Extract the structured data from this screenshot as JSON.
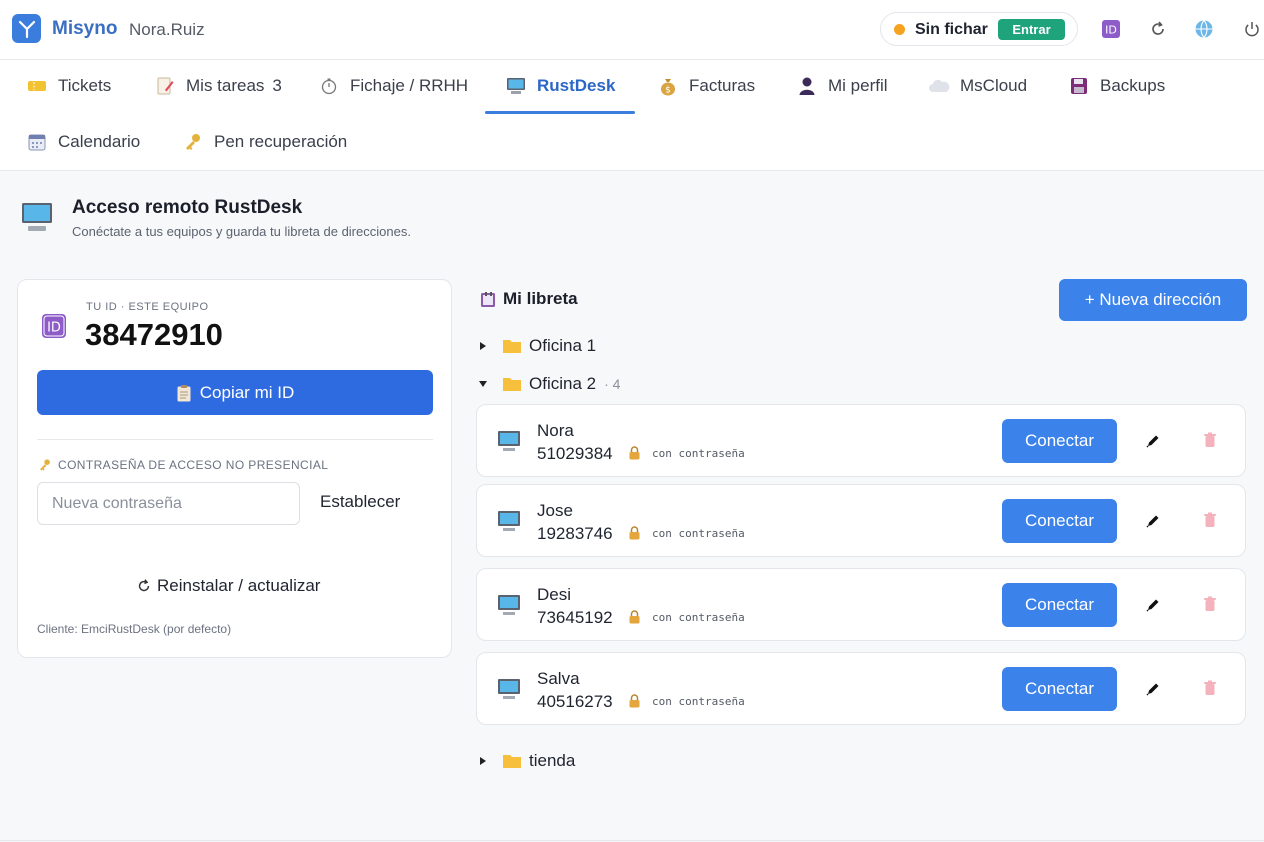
{
  "header": {
    "brand": "Misyno",
    "user": "Nora.Ruiz",
    "clock_status": "Sin fichar",
    "clock_button": "Entrar",
    "icons": [
      "id-card-icon",
      "refresh-icon",
      "globe-icon",
      "power-icon"
    ]
  },
  "nav": {
    "items": [
      {
        "label": "Tickets",
        "icon": "ticket-icon"
      },
      {
        "label": "Mis tareas",
        "badge": "3",
        "icon": "memo-icon"
      },
      {
        "label": "Fichaje / RRHH",
        "icon": "stopwatch-icon"
      },
      {
        "label": "RustDesk",
        "icon": "computer-icon",
        "active": true
      },
      {
        "label": "Facturas",
        "icon": "money-bag-icon"
      },
      {
        "label": "Mi perfil",
        "icon": "person-icon"
      },
      {
        "label": "MsCloud",
        "icon": "cloud-icon"
      },
      {
        "label": "Backups",
        "icon": "floppy-icon"
      },
      {
        "label": "Calendario",
        "icon": "calendar-icon"
      },
      {
        "label": "Pen recuperación",
        "icon": "key-icon"
      }
    ]
  },
  "page": {
    "title": "Acceso remoto RustDesk",
    "subtitle": "Conéctate a tus equipos y guarda tu libreta de direcciones."
  },
  "my_id": {
    "label": "TU ID · ESTE EQUIPO",
    "value": "38472910",
    "copy_button": "Copiar mi ID",
    "password_label": "CONTRASEÑA DE ACCESO NO PRESENCIAL",
    "password_placeholder": "Nueva contraseña",
    "set_button": "Establecer",
    "reinstall": "Reinstalar / actualizar",
    "client_note": "Cliente: EmciRustDesk (por defecto)"
  },
  "address_book": {
    "title": "Mi libreta",
    "new_button": "+ Nueva dirección",
    "groups": [
      {
        "name": "Oficina 1",
        "expanded": false
      },
      {
        "name": "Oficina 2",
        "expanded": true,
        "count": "· 4"
      },
      {
        "name": "tienda",
        "expanded": false
      }
    ],
    "devices": [
      {
        "name": "Nora",
        "id": "51029384",
        "pwd": "con contraseña"
      },
      {
        "name": "Jose",
        "id": "19283746",
        "pwd": "con contraseña"
      },
      {
        "name": "Desi",
        "id": "73645192",
        "pwd": "con contraseña"
      },
      {
        "name": "Salva",
        "id": "40516273",
        "pwd": "con contraseña"
      }
    ],
    "connect_label": "Conectar"
  },
  "colors": {
    "accent": "#3b82ea",
    "primary_dark": "#2f6be0",
    "success": "#1fa37a",
    "warning_dot": "#f5a21e"
  }
}
